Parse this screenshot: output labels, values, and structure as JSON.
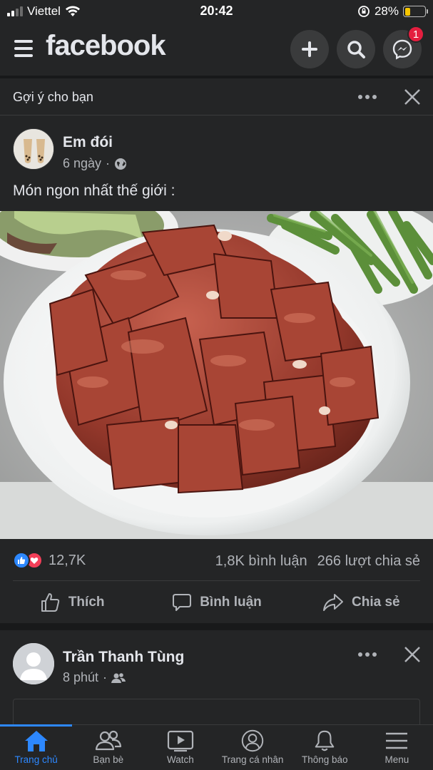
{
  "status_bar": {
    "carrier": "Viettel",
    "time": "20:42",
    "battery": "28%",
    "battery_level": 0.28
  },
  "header": {
    "logo": "facebook",
    "messenger_badge": "1",
    "icons": [
      "menu-icon",
      "plus-icon",
      "search-icon",
      "messenger-icon"
    ]
  },
  "suggestion": {
    "title": "Gợi ý cho bạn"
  },
  "post": {
    "author": "Em đói",
    "time": "6 ngày",
    "separator": "·",
    "text": "Món ngon nhất thế giới :",
    "reactions_count": "12,7K",
    "comments": "1,8K bình luận",
    "shares": "266 lượt chia sẻ",
    "actions": {
      "like": "Thích",
      "comment": "Bình luận",
      "share": "Chia sẻ"
    }
  },
  "post2": {
    "author": "Trần Thanh Tùng",
    "time": "8 phút",
    "separator": "·"
  },
  "tabs": [
    {
      "label": "Trang chủ",
      "icon": "home-icon",
      "active": true
    },
    {
      "label": "Bạn bè",
      "icon": "friends-icon",
      "active": false
    },
    {
      "label": "Watch",
      "icon": "watch-icon",
      "active": false
    },
    {
      "label": "Trang cá nhân",
      "icon": "profile-icon",
      "active": false
    },
    {
      "label": "Thông báo",
      "icon": "bell-icon",
      "active": false
    },
    {
      "label": "Menu",
      "icon": "menu-icon",
      "active": false
    }
  ],
  "colors": {
    "background": "#18191a",
    "card": "#242526",
    "accent": "#2d88ff",
    "badge": "#e41e3f"
  }
}
